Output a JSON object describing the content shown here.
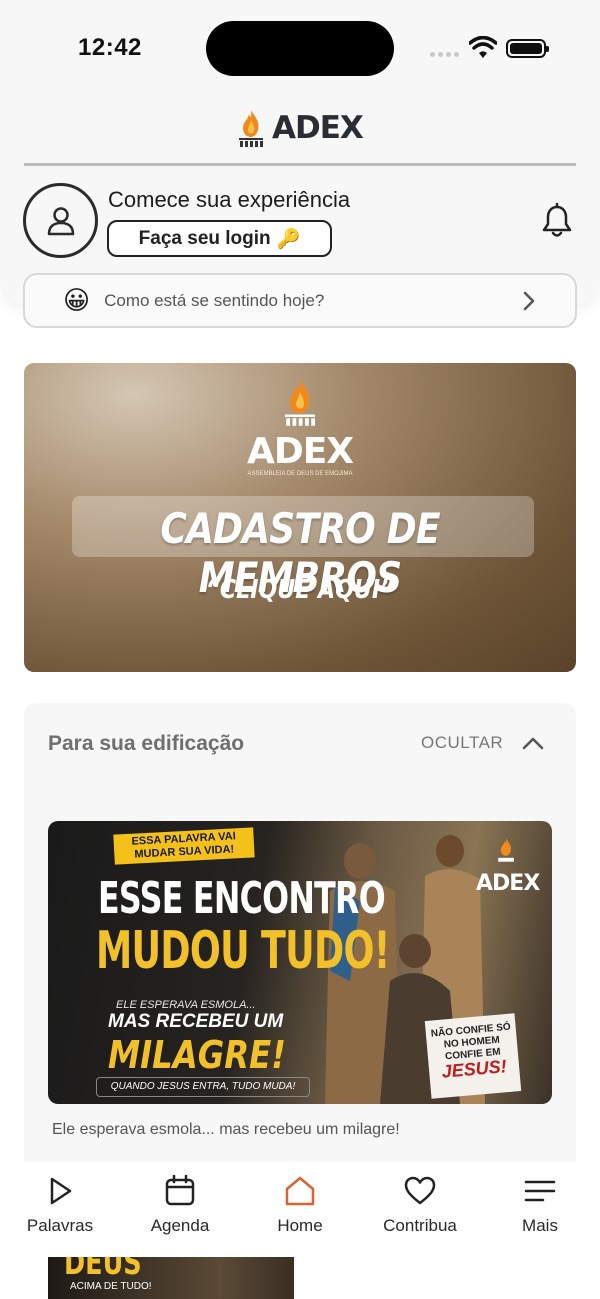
{
  "status_bar": {
    "time": "12:42"
  },
  "header": {
    "brand": "ADEX",
    "welcome_text": "Comece sua experiência",
    "login_label": "Faça seu login",
    "login_emoji": "🔑"
  },
  "mood": {
    "emoji": "😀",
    "prompt": "Como está se sentindo hoje?"
  },
  "banner": {
    "brand": "ADEX",
    "subtitle": "ASSEMBLEIA DE DEUS DE EMOJIMA",
    "title": "CADASTRO DE MEMBROS",
    "cta": "“CLIQUE AQUI”"
  },
  "edification": {
    "title": "Para sua edificação",
    "hide_label": "OCULTAR",
    "post": {
      "tag": "ESSA PALAVRA VAI MUDAR SUA VIDA!",
      "headline_1": "ESSE ENCONTRO",
      "headline_2": "MUDOU TUDO!",
      "line_small": "ELE ESPERAVA ESMOLA...",
      "line_mid": "MAS RECEBEU UM",
      "line_big": "MILAGRE!",
      "strip": "QUANDO JESUS ENTRA, TUDO MUDA!",
      "card_top": "NÃO CONFIE SÓ NO HOMEM CONFIE EM",
      "card_bottom": "JESUS!",
      "brand": "ADEX",
      "caption": "Ele esperava esmola... mas recebeu um milagre!"
    },
    "next_post": {
      "headline": "DEUS",
      "sub": "ACIMA DE TUDO!"
    }
  },
  "tabbar": {
    "active": "Home",
    "active_color": "#e0612f",
    "items": [
      {
        "label": "Palavras",
        "icon": "play-icon"
      },
      {
        "label": "Agenda",
        "icon": "calendar-icon"
      },
      {
        "label": "Home",
        "icon": "home-icon"
      },
      {
        "label": "Contribua",
        "icon": "heart-icon"
      },
      {
        "label": "Mais",
        "icon": "menu-icon"
      }
    ]
  }
}
